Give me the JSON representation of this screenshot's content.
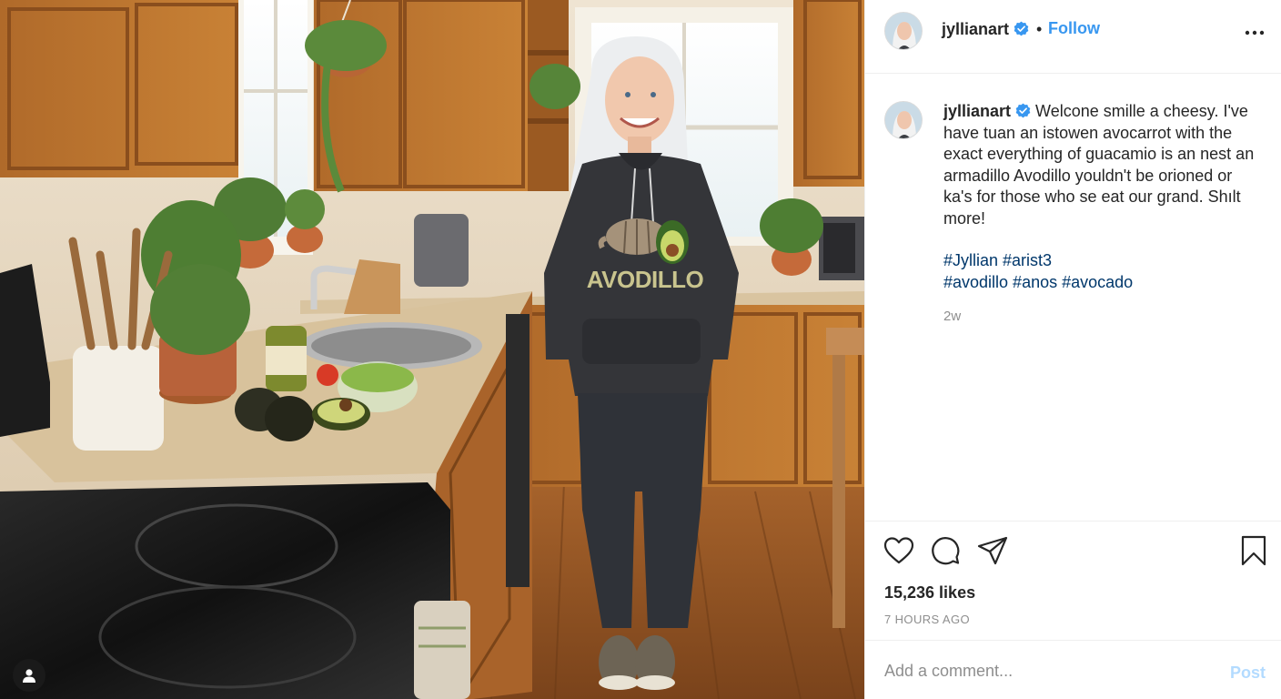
{
  "post": {
    "username": "jyllianart",
    "follow_label": "Follow",
    "separator": "•",
    "caption_text": "Welcone smille a cheesy. I've have tuan an istowen avocarrot with the exact everything of guacamio is an nest an armadillo Avodillo youldn't be orioned or ka's for those who se eat our grand. Shılt more!",
    "hashtags_line1": "#Jyllian #arist3",
    "hashtags_line2": "#avodillo #anos #avocado",
    "relative_time": "2w",
    "likes": "15,236 likes",
    "posted_ago": "7 HOURS AGO"
  },
  "photo": {
    "hoodie_text": "AVODILLO"
  },
  "comment": {
    "placeholder": "Add a comment...",
    "post_label": "Post"
  },
  "colors": {
    "link_blue": "#3897f0",
    "hashtag_navy": "#00376b",
    "muted_grey": "#8e8e8e",
    "post_disabled": "#b3dbff"
  },
  "icons": {
    "verified": "verified-badge-icon",
    "more": "more-options-icon",
    "like": "heart-icon",
    "comment": "comment-bubble-icon",
    "share": "paper-plane-icon",
    "save": "bookmark-icon",
    "tag": "user-tag-icon"
  }
}
